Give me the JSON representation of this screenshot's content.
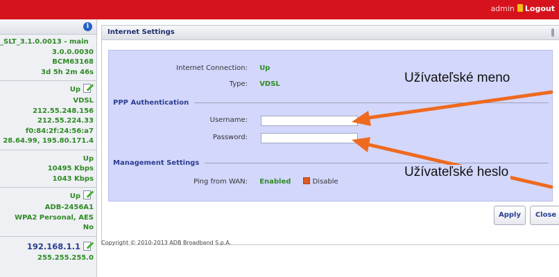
{
  "topbar": {
    "username": "admin",
    "logout_label": "Logout"
  },
  "sidebar": {
    "system": {
      "firmware": "_SLT_3.1.0.0013 - main",
      "version": "3.0.0.0030",
      "chipset": "BCM63168",
      "uptime": "3d 5h 2m 46s"
    },
    "internet": {
      "status": "Up",
      "type": "VDSL",
      "ip": "212.55.248.156",
      "gateway": "212.55.224.33",
      "mac": "f0:84:2f:24:56:a7",
      "dns": "28.64.99, 195.80.171.4"
    },
    "dsl": {
      "status": "Up",
      "downstream": "10495 Kbps",
      "upstream": "1043 Kbps"
    },
    "wifi": {
      "status": "Up",
      "ssid": "ADB-2456A1",
      "security": "WPA2 Personal, AES",
      "wps": "No"
    },
    "lan": {
      "ip": "192.168.1.1",
      "mask": "255.255.255.0"
    }
  },
  "panel": {
    "title": "Internet Settings",
    "connection_label": "Internet Connection:",
    "connection_value": "Up",
    "type_label": "Type:",
    "type_value": "VDSL",
    "ppp_section": "PPP Authentication",
    "username_label": "Username:",
    "username_value": "",
    "password_label": "Password:",
    "password_value": "",
    "mgmt_section": "Management Settings",
    "ping_label": "Ping from WAN:",
    "ping_value": "Enabled",
    "disable_label": "Disable",
    "apply_label": "Apply",
    "close_label": "Close"
  },
  "footer": {
    "copyright": "Copyright © 2010-2013 ADB Broadband S.p.A."
  },
  "annotations": {
    "username_callout": "Užívateľské meno",
    "password_callout": "Užívateľské heslo"
  },
  "colors": {
    "topbar": "#d6131d",
    "status_green": "#2f8a25",
    "panel_bg": "#d3d7fb",
    "arrow": "#ee6a1f"
  }
}
